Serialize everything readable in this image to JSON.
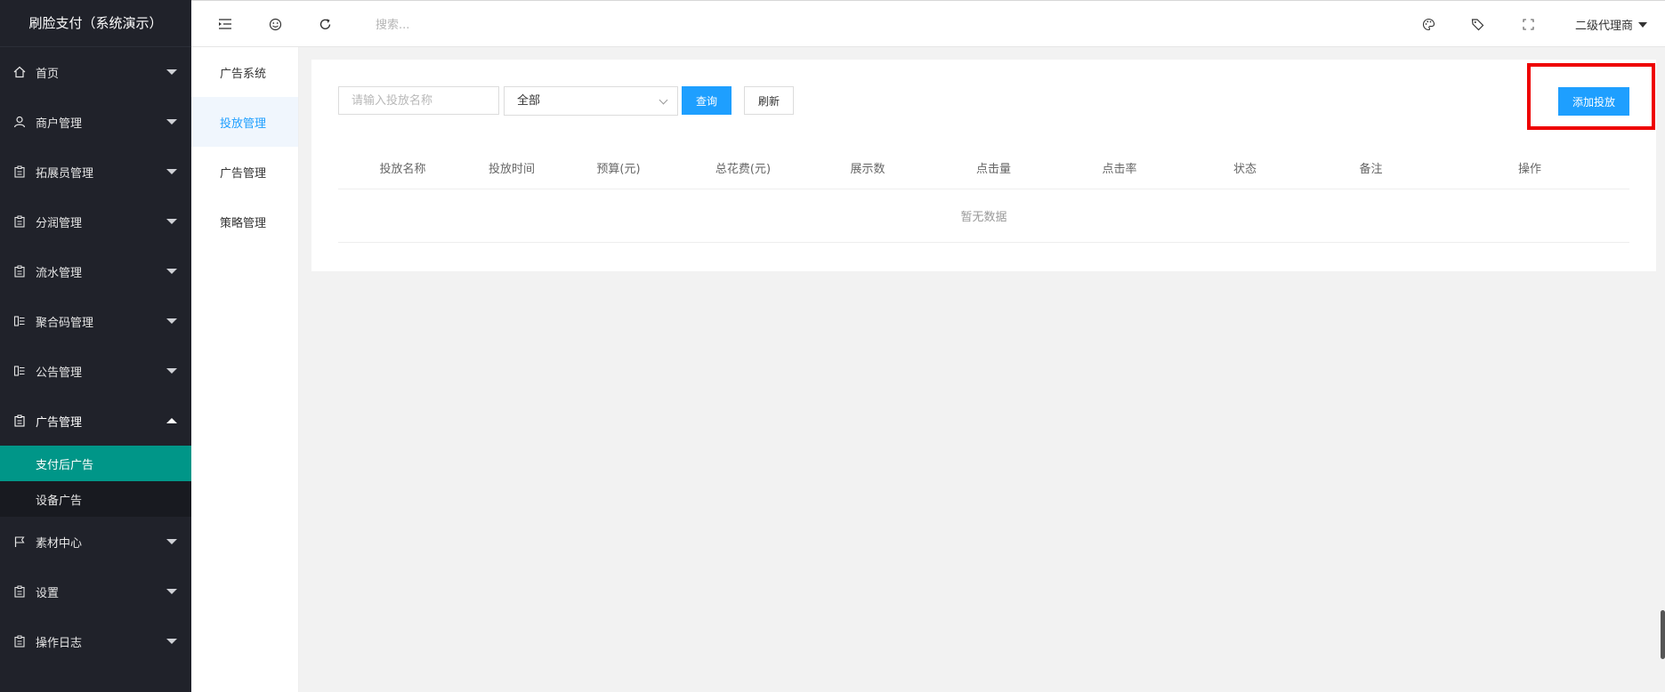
{
  "sidebar": {
    "brand": "刷脸支付（系统演示）",
    "items": [
      {
        "label": "首页",
        "icon": "home-icon"
      },
      {
        "label": "商户管理",
        "icon": "user-icon"
      },
      {
        "label": "拓展员管理",
        "icon": "clipboard-icon"
      },
      {
        "label": "分润管理",
        "icon": "clipboard-icon"
      },
      {
        "label": "流水管理",
        "icon": "clipboard-icon"
      },
      {
        "label": "聚合码管理",
        "icon": "list-icon"
      },
      {
        "label": "公告管理",
        "icon": "list-icon"
      },
      {
        "label": "广告管理",
        "icon": "clipboard-icon",
        "expanded": true
      },
      {
        "label": "素材中心",
        "icon": "flag-icon"
      },
      {
        "label": "设置",
        "icon": "clipboard-icon"
      },
      {
        "label": "操作日志",
        "icon": "clipboard-icon"
      }
    ],
    "ad_submenu": [
      {
        "label": "支付后广告",
        "active": true
      },
      {
        "label": "设备广告",
        "active": false
      }
    ]
  },
  "header": {
    "search_placeholder": "搜索...",
    "user_name": "二级代理商",
    "icons": [
      "menu-collapse-icon",
      "emoji-icon",
      "refresh-icon",
      "palette-icon",
      "tag-icon",
      "fullscreen-icon"
    ]
  },
  "subnav": {
    "items": [
      {
        "label": "广告系统",
        "active": false
      },
      {
        "label": "投放管理",
        "active": true
      },
      {
        "label": "广告管理",
        "active": false
      },
      {
        "label": "策略管理",
        "active": false
      }
    ]
  },
  "toolbar": {
    "name_placeholder": "请输入投放名称",
    "status_select": "全部",
    "query_label": "查询",
    "refresh_label": "刷新",
    "add_label": "添加投放"
  },
  "table": {
    "columns": [
      "投放名称",
      "投放时间",
      "预算(元)",
      "总花费(元)",
      "展示数",
      "点击量",
      "点击率",
      "状态",
      "备注",
      "操作"
    ],
    "empty_text": "暂无数据"
  },
  "colors": {
    "sidebar_bg": "#20222a",
    "active_green": "#009688",
    "primary_blue": "#1e9fff",
    "highlight_red": "#ee0000"
  }
}
